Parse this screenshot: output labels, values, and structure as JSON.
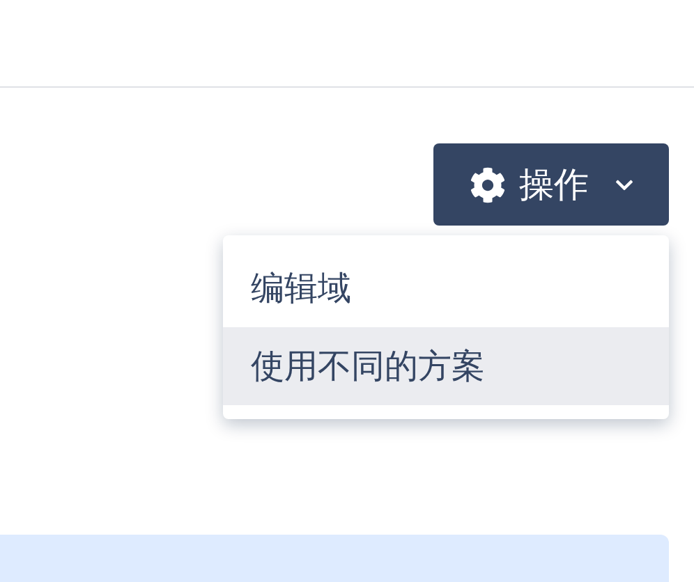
{
  "action_button": {
    "label": "操作",
    "expanded": true
  },
  "menu": {
    "items": [
      {
        "label": "编辑域",
        "selected": false
      },
      {
        "label": "使用不同的方案",
        "selected": true
      }
    ]
  }
}
